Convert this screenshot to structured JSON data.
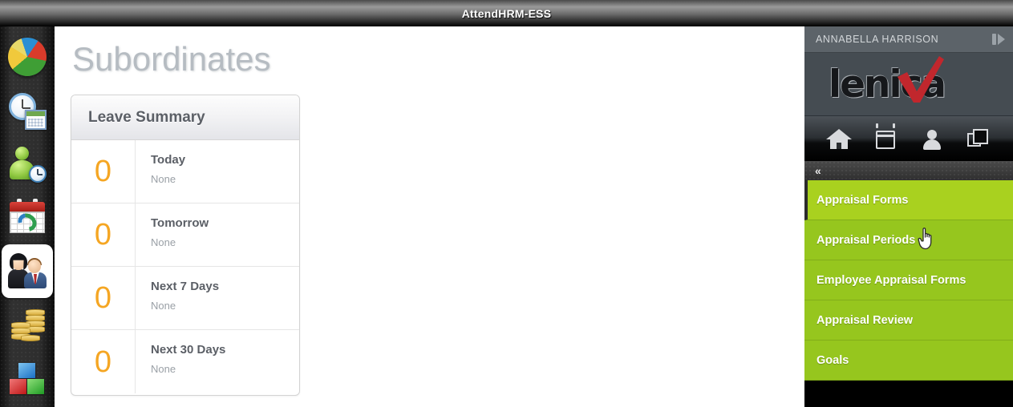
{
  "window": {
    "title": "AttendHRM-ESS"
  },
  "rail": {
    "items": [
      {
        "name": "dashboard",
        "icon": "pie-chart-icon",
        "selected": false
      },
      {
        "name": "time-attendance",
        "icon": "clock-calendar-icon",
        "selected": false
      },
      {
        "name": "employee-time",
        "icon": "person-clock-icon",
        "selected": false
      },
      {
        "name": "leave-calendar",
        "icon": "calendar-sync-icon",
        "selected": false
      },
      {
        "name": "subordinates",
        "icon": "people-icon",
        "selected": true
      },
      {
        "name": "payroll",
        "icon": "coins-icon",
        "selected": false
      },
      {
        "name": "modules",
        "icon": "blocks-icon",
        "selected": false
      }
    ]
  },
  "main": {
    "page_title": "Subordinates",
    "leave_summary": {
      "header": "Leave Summary",
      "rows": [
        {
          "count": "0",
          "label": "Today",
          "sub": "None"
        },
        {
          "count": "0",
          "label": "Tomorrow",
          "sub": "None"
        },
        {
          "count": "0",
          "label": "Next 7 Days",
          "sub": "None"
        },
        {
          "count": "0",
          "label": "Next 30 Days",
          "sub": "None"
        }
      ]
    }
  },
  "right_panel": {
    "user_name": "ANNABELLA HARRISON",
    "expand_icon": "expand-panel-icon",
    "logo_text": "lenica",
    "logo_mark": "red-checkmark",
    "nav_icons": [
      {
        "name": "home-icon"
      },
      {
        "name": "calendar-icon"
      },
      {
        "name": "person-icon"
      },
      {
        "name": "windows-icon"
      }
    ],
    "collapse_chevron": "«",
    "menu": [
      {
        "label": "Appraisal Forms",
        "active": true
      },
      {
        "label": "Appraisal Periods",
        "active": false
      },
      {
        "label": "Employee Appraisal Forms",
        "active": false
      },
      {
        "label": "Appraisal Review",
        "active": false
      },
      {
        "label": "Goals",
        "active": false
      }
    ]
  },
  "colors": {
    "menu_green": "#96c61e",
    "menu_green_active": "#a9d11f",
    "count_orange": "#f5a623",
    "logo_red": "#c1272d",
    "panel_header_gray": "#5c6369"
  }
}
